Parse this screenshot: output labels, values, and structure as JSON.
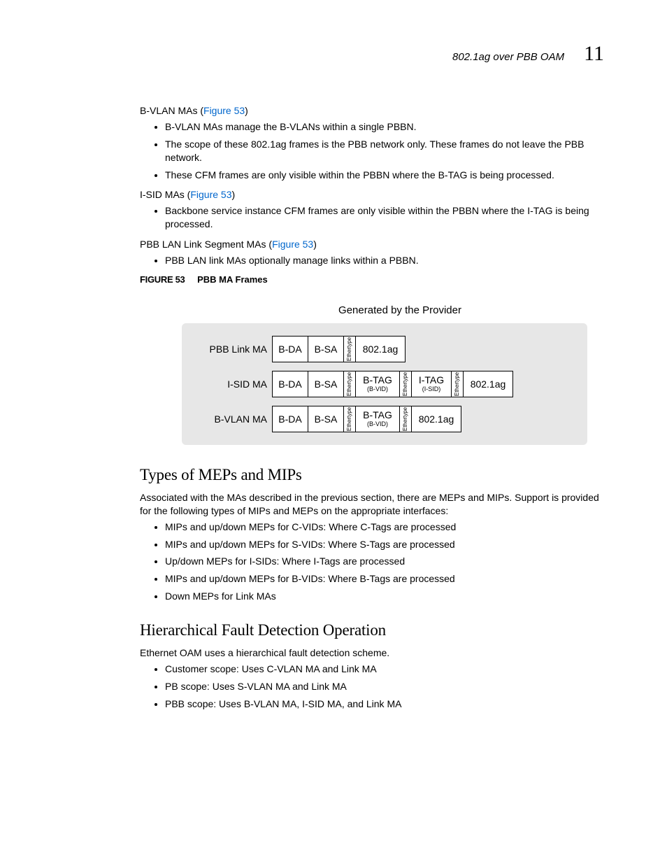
{
  "header": {
    "text": "802.1ag over PBB OAM",
    "chapter": "11"
  },
  "bvlan": {
    "heading_pre": "B-VLAN MAs (",
    "link": "Figure 53",
    "heading_post": ")",
    "items": [
      "B-VLAN MAs manage the B-VLANs within a single PBBN.",
      "The scope of these 802.1ag frames is the PBB network only. These frames do not leave the PBB network.",
      "These CFM frames are only visible within the PBBN where the B-TAG is being processed."
    ]
  },
  "isid": {
    "heading_pre": "I-SID MAs (",
    "link": "Figure 53",
    "heading_post": ")",
    "items": [
      "Backbone service instance CFM frames are only visible within the PBBN where the I-TAG is being processed."
    ]
  },
  "pbblan": {
    "heading_pre": "PBB LAN Link Segment MAs (",
    "link": "Figure 53",
    "heading_post": ")",
    "items": [
      "PBB LAN link MAs optionally manage links within a PBBN."
    ]
  },
  "figure": {
    "label": "FIGURE 53",
    "title": "PBB MA Frames",
    "caption": "Generated by the Provider",
    "rows": {
      "r1": {
        "label": "PBB Link MA"
      },
      "r2": {
        "label": "I-SID MA"
      },
      "r3": {
        "label": "B-VLAN MA"
      }
    },
    "cells": {
      "bda": "B-DA",
      "bsa": "B-SA",
      "et": "Ethertype",
      "btag": "B-TAG",
      "btag_sub": "(B-VID)",
      "itag": "I-TAG",
      "itag_sub": "(I-SID)",
      "ag": "802.1ag"
    }
  },
  "types": {
    "title": "Types of MEPs and MIPs",
    "intro": "Associated with the MAs described in the previous section, there are MEPs and MIPs. Support is provided for the following types of MIPs and MEPs on the appropriate interfaces:",
    "items": [
      "MIPs and up/down MEPs for C-VIDs: Where C-Tags are processed",
      "MIPs and up/down MEPs for S-VIDs: Where S-Tags are processed",
      "Up/down MEPs for I-SIDs: Where I-Tags are processed",
      "MIPs and up/down MEPs for B-VIDs: Where B-Tags are processed",
      "Down MEPs for Link MAs"
    ]
  },
  "hier": {
    "title": "Hierarchical Fault Detection Operation",
    "intro": "Ethernet OAM uses a hierarchical fault detection scheme.",
    "items": [
      "Customer scope: Uses C-VLAN MA and Link MA",
      "PB scope: Uses S-VLAN MA and Link MA",
      "PBB scope: Uses B-VLAN MA, I-SID MA, and Link MA"
    ]
  }
}
